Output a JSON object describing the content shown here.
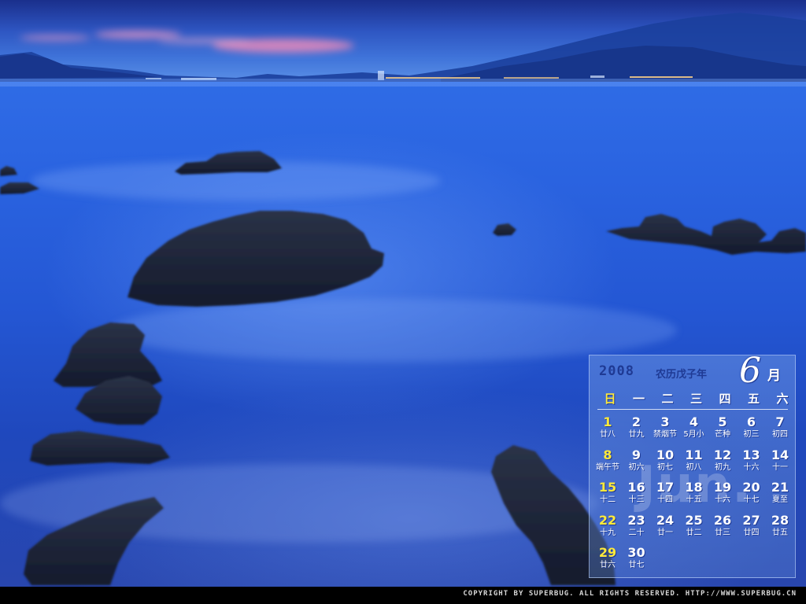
{
  "calendar": {
    "year": "2008",
    "lunar_year": "农历戊子年",
    "month_number": "6",
    "month_suffix": "月",
    "watermark": "Jun.",
    "weekdays": [
      "日",
      "一",
      "二",
      "三",
      "四",
      "五",
      "六"
    ],
    "days": [
      {
        "n": "1",
        "l": "廿八"
      },
      {
        "n": "2",
        "l": "廿九"
      },
      {
        "n": "3",
        "l": "禁烟节"
      },
      {
        "n": "4",
        "l": "5月小"
      },
      {
        "n": "5",
        "l": "芒种"
      },
      {
        "n": "6",
        "l": "初三"
      },
      {
        "n": "7",
        "l": "初四"
      },
      {
        "n": "8",
        "l": "端午节"
      },
      {
        "n": "9",
        "l": "初六"
      },
      {
        "n": "10",
        "l": "初七"
      },
      {
        "n": "11",
        "l": "初八"
      },
      {
        "n": "12",
        "l": "初九"
      },
      {
        "n": "13",
        "l": "十六"
      },
      {
        "n": "14",
        "l": "十一"
      },
      {
        "n": "15",
        "l": "十二"
      },
      {
        "n": "16",
        "l": "十三"
      },
      {
        "n": "17",
        "l": "十四"
      },
      {
        "n": "18",
        "l": "十五"
      },
      {
        "n": "19",
        "l": "十六"
      },
      {
        "n": "20",
        "l": "十七"
      },
      {
        "n": "21",
        "l": "夏至"
      },
      {
        "n": "22",
        "l": "十九"
      },
      {
        "n": "23",
        "l": "二十"
      },
      {
        "n": "24",
        "l": "廿一"
      },
      {
        "n": "25",
        "l": "廿二"
      },
      {
        "n": "26",
        "l": "廿三"
      },
      {
        "n": "27",
        "l": "廿四"
      },
      {
        "n": "28",
        "l": "廿五"
      },
      {
        "n": "29",
        "l": "廿六"
      },
      {
        "n": "30",
        "l": "廿七"
      }
    ],
    "first_weekday_index": 0,
    "colors": {
      "weekend_accent": "#ffea3a",
      "outline": "#1f3a94"
    }
  },
  "footer": {
    "copyright": "COPYRIGHT BY SUPERBUG.  ALL RIGHTS RESERVED.  HTTP://WWW.SUPERBUG.CN"
  },
  "scene": {
    "subject": "rocky-seashore-at-dusk",
    "colors": {
      "sky_top": "#1a2f8c",
      "sea": "#2457d4",
      "clouds": "#ff8fb8",
      "rocks": "#1b2236",
      "shore_lights": "#ffd38a"
    }
  }
}
